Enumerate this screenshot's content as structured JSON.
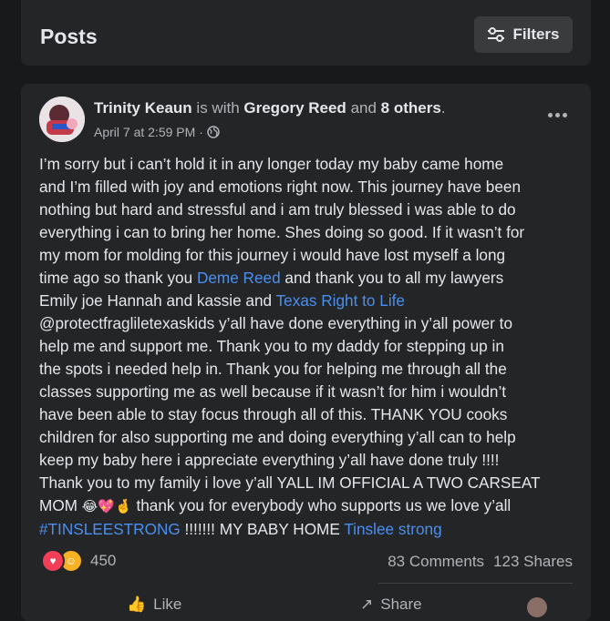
{
  "header": {
    "title": "Posts",
    "filters_label": "Filters"
  },
  "post": {
    "author": "Trinity Keaun",
    "is_with": "is with",
    "tagged_person": "Gregory Reed",
    "and_text": "and",
    "others": "8 others",
    "period": ".",
    "date": "April 7 at 2:59 PM",
    "sep": "·",
    "privacy_icon": "globe-icon",
    "lines": {
      "l1": "I’m sorry but i can’t hold it in any longer today my baby came home",
      "l2": "and I’m filled with joy and emotions right now. This journey have been",
      "l3": "nothing but hard and stressful and i am truly blessed i was able to do",
      "l4": "everything i can to bring her home. Shes doing so good. If it wasn’t for",
      "l5": "my mom for molding for this journey i would have lost myself a long",
      "l6a": "time ago so thank you ",
      "l6_link": "Deme Reed",
      "l6b": " and thank you to all my lawyers",
      "l7a": "Emily joe Hannah and  kassie and ",
      "l7_link": "Texas Right to Life",
      "l8": "@protectfraglileteхaskids y’all have done everything in y’all power to",
      "l9": "help me and support me. Thank  you to my daddy for stepping up in",
      "l10": "the spots i needed help in. Thank you for  helping me through all the",
      "l11": "classes supporting me as well because if it wasn’t for him i wouldn’t",
      "l12": "have been able to stay focus through all of this. THANK YOU cooks",
      "l13": "children for also supporting me and doing everything y’all can to help",
      "l14": "keep my baby here i appreciate everything y’all have done truly !!!!",
      "l15": "Thank you to my family i love y’all YALL IM OFFICIAL A TWO CARSEAT",
      "l16a": "MOM ",
      "l16_emoji": "😂💖🤞",
      "l16b": "  thank you for everybody who supports us we love y’all",
      "l17_link1": "#TINSLEESTRONG",
      "l17_text": " !!!!!!! MY BABY HOME ",
      "l17_link2": "Tinslee strong"
    },
    "reaction_count": "450",
    "comments": "83 Comments",
    "shares": "123 Shares",
    "actions": {
      "like": "Like",
      "share": "Share"
    }
  },
  "colors": {
    "background": "#18191a",
    "card": "#242526",
    "link": "#4b8ff0",
    "love": "#f33e58",
    "care": "#f7b125"
  }
}
